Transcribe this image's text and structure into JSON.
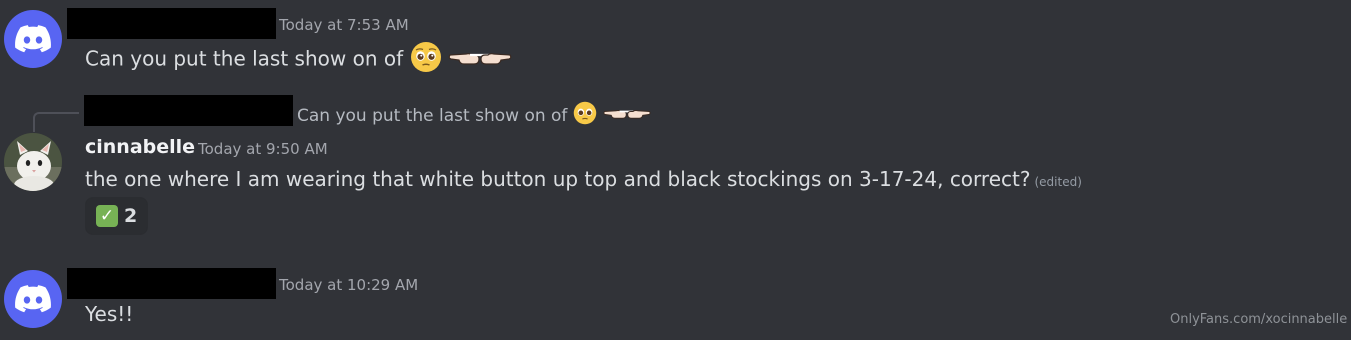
{
  "messages": [
    {
      "timestamp": "Today at 7:53 AM",
      "text": "Can you put the last show on of",
      "avatar_icon": "discord-logo-icon"
    },
    {
      "reply_preview": "Can you put the last show on of",
      "username": "cinnabelle",
      "timestamp": "Today at 9:50 AM",
      "text": "the one where I am wearing that white button up top and black stockings on 3-17-24, correct?",
      "edited_label": "(edited)",
      "reaction": {
        "emoji": "white-check-mark-emoji",
        "count": "2"
      }
    },
    {
      "timestamp": "Today at 10:29 AM",
      "text": "Yes!!",
      "avatar_icon": "discord-logo-icon"
    }
  ],
  "watermark": "OnlyFans.com/xocinnabelle",
  "colors": {
    "background": "#313338",
    "discord_blurple": "#5865f2",
    "redaction": "#000000",
    "check_green": "#77b255"
  }
}
